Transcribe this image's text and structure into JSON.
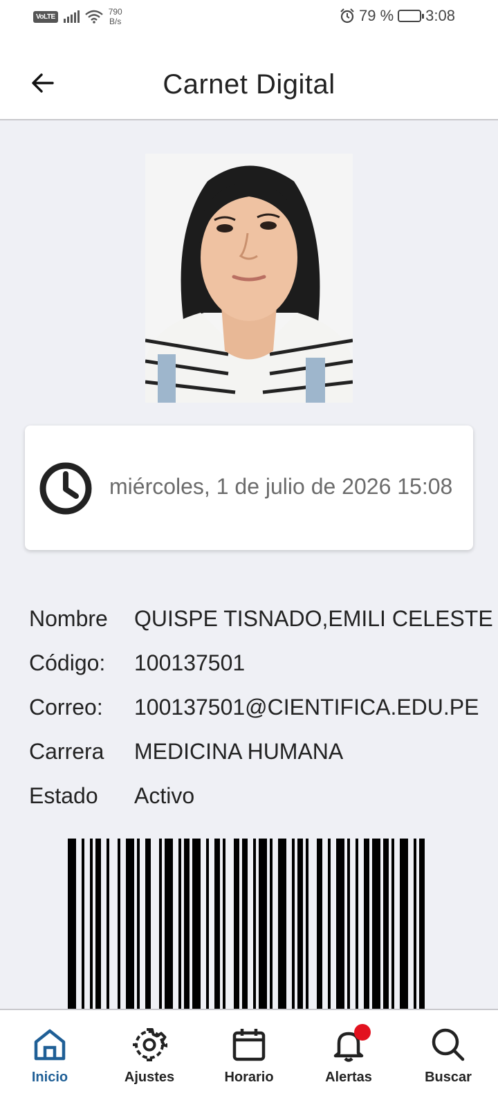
{
  "status_bar": {
    "volte": "VoLTE",
    "net_speed_value": "790",
    "net_speed_unit": "B/s",
    "battery": "79 %",
    "battery_level": 0.79,
    "time": "3:08",
    "icons": [
      "signal-icon",
      "wifi-icon",
      "alarm-icon",
      "battery-icon"
    ]
  },
  "header": {
    "title": "Carnet Digital",
    "back_icon": "arrow-left-icon"
  },
  "photo": {
    "alt": "Foto del estudiante"
  },
  "clock_card": {
    "icon": "clock-icon",
    "datetime": "miércoles, 1 de julio de 2026 15:08"
  },
  "info": {
    "rows": [
      {
        "label": "Nombre",
        "value": "QUISPE TISNADO,EMILI CELESTE"
      },
      {
        "label": "Código:",
        "value": "100137501"
      },
      {
        "label": "Correo:",
        "value": "100137501@CIENTIFICA.EDU.PE"
      },
      {
        "label": "Carrera",
        "value": "MEDICINA HUMANA"
      },
      {
        "label": "Estado",
        "value": "Activo"
      }
    ]
  },
  "barcode": {
    "icon": "barcode"
  },
  "bottom_nav": {
    "items": [
      {
        "label": "Inicio",
        "icon": "home-icon",
        "active": true
      },
      {
        "label": "Ajustes",
        "icon": "gear-icon",
        "active": false
      },
      {
        "label": "Horario",
        "icon": "calendar-icon",
        "active": false
      },
      {
        "label": "Alertas",
        "icon": "bell-icon",
        "active": false,
        "badge": true
      },
      {
        "label": "Buscar",
        "icon": "search-icon",
        "active": false
      }
    ]
  },
  "colors": {
    "accent": "#1f5f96",
    "background": "#eff0f5",
    "badge": "#e2121f"
  }
}
